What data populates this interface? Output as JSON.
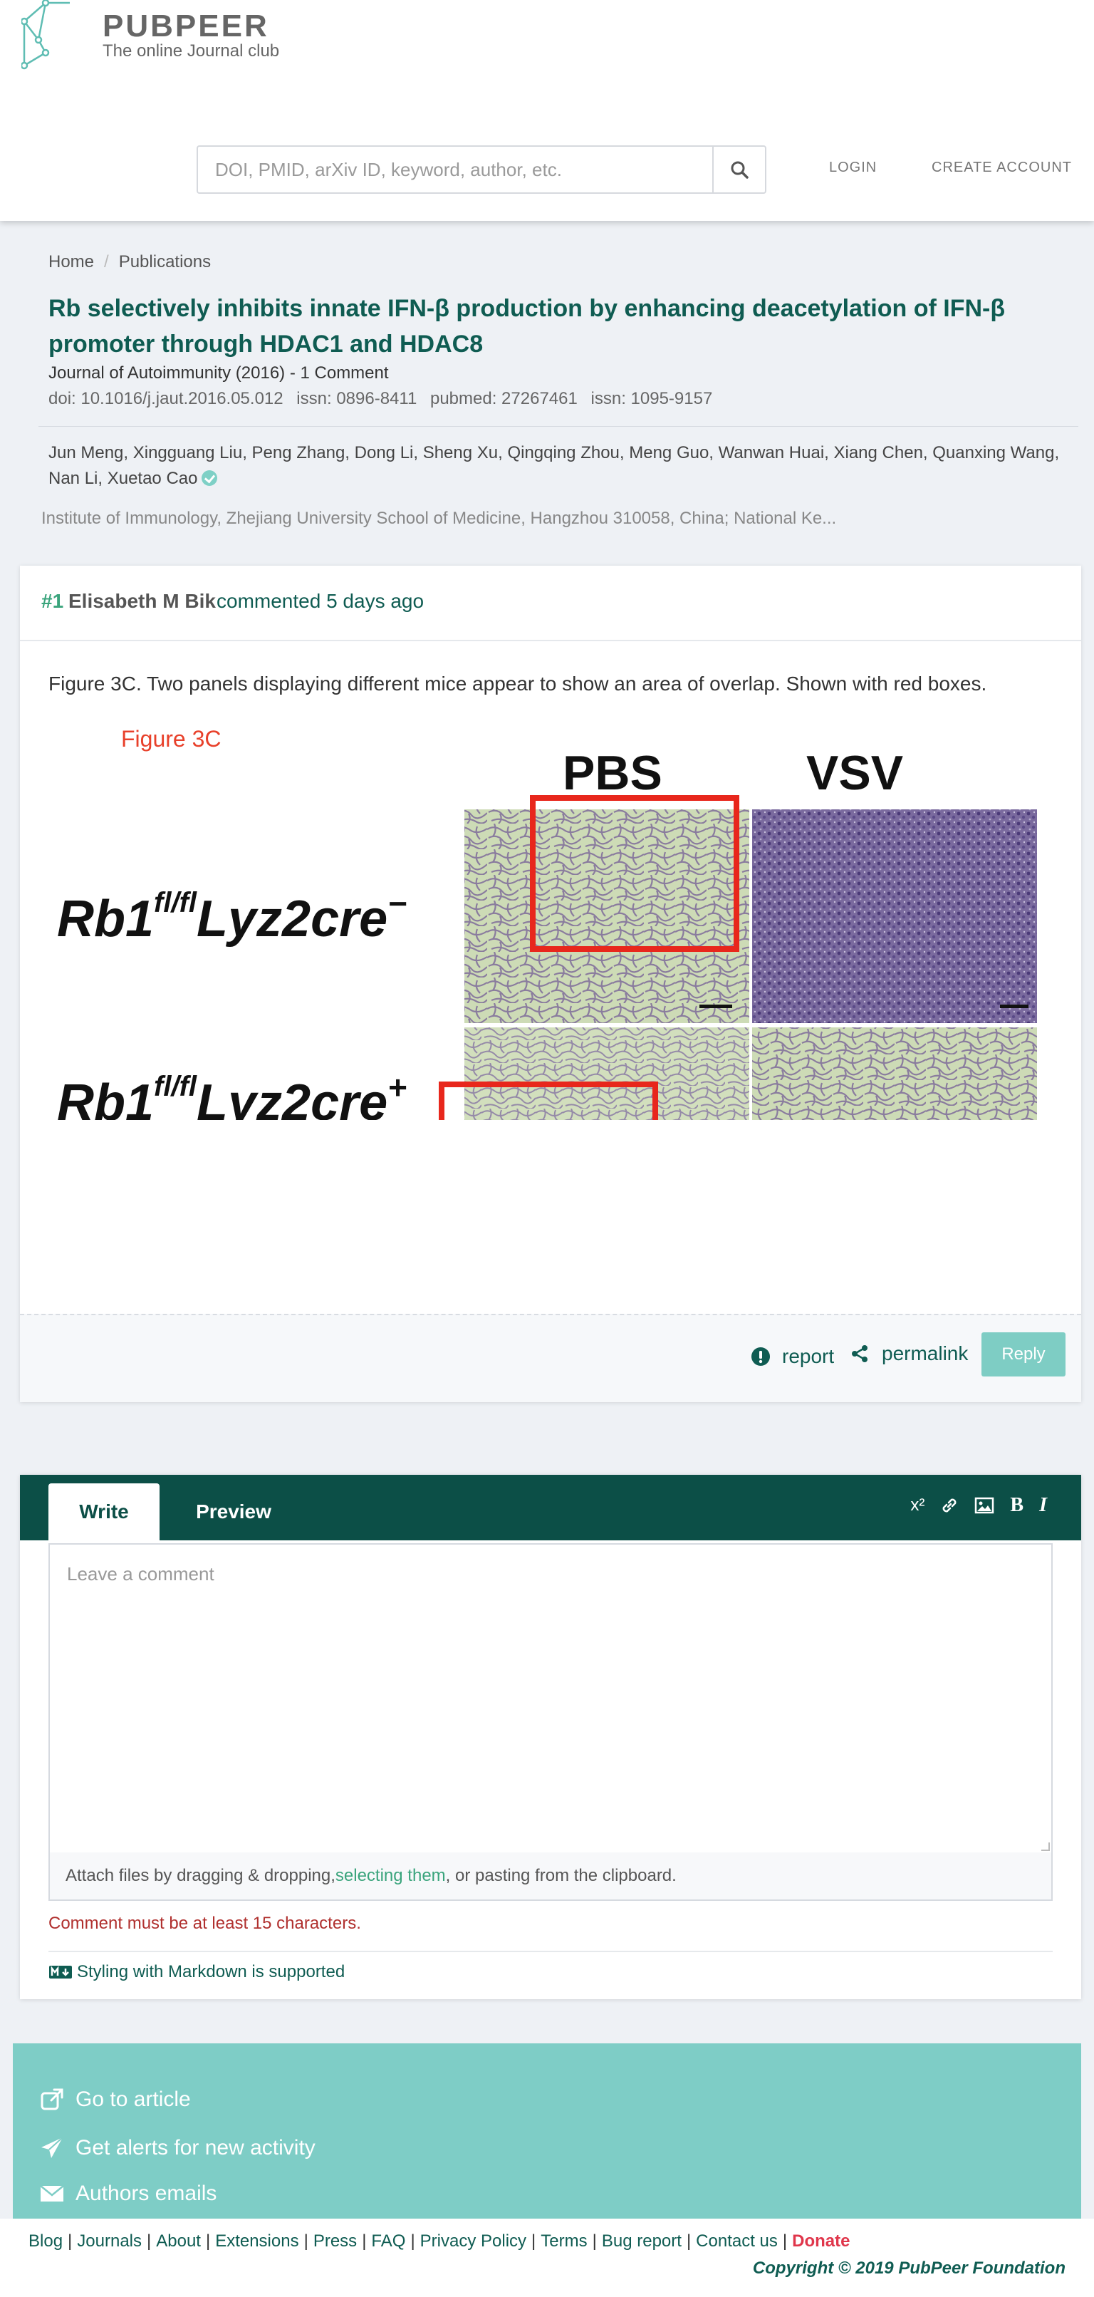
{
  "header": {
    "brand": "PUBPEER",
    "tagline": "The online Journal club",
    "search_placeholder": "DOI, PMID, arXiv ID, keyword, author, etc.",
    "login": "LOGIN",
    "create_account": "CREATE ACCOUNT"
  },
  "breadcrumb": {
    "home": "Home",
    "publications": "Publications"
  },
  "publication": {
    "title": "Rb selectively inhibits innate IFN-β production by enhancing deacetylation of IFN-β promoter through HDAC1 and HDAC8",
    "journal": "Journal of Autoimmunity (2016) - 1 Comment",
    "doi": "doi: 10.1016/j.jaut.2016.05.012",
    "issn1": "issn: 0896-8411",
    "pubmed": "pubmed: 27267461",
    "issn2": "issn: 1095-9157",
    "authors": "Jun Meng, Xingguang Liu, Peng Zhang, Dong Li, Sheng Xu, Qingqing Zhou, Meng Guo, Wanwan Huai, Xiang Chen, Quanxing Wang, Nan Li, Xuetao Cao",
    "affiliation": "Institute of Immunology, Zhejiang University School of Medicine, Hangzhou 310058, China; National Ke..."
  },
  "comment": {
    "number": "#1",
    "author": "Elisabeth M Bik",
    "when": "commented 5 days ago",
    "text": "Figure 3C. Two panels displaying different mice appear to show an area of overlap. Shown with red boxes.",
    "figure": {
      "label": "Figure 3C",
      "col1": "PBS",
      "col2": "VSV",
      "row1_main": "Rb1",
      "row1_sup": "fl/fl",
      "row1_tail": "Lyz2cre",
      "row1_sign": "−",
      "row2_main": "Rb1",
      "row2_sup": "fl/fl",
      "row2_tail": "Lyz2cre",
      "row2_sign": "+"
    },
    "report": "report",
    "permalink": "permalink",
    "reply": "Reply"
  },
  "editor": {
    "tab_write": "Write",
    "tab_preview": "Preview",
    "tool_sup": "x²",
    "tool_bold": "B",
    "tool_italic": "I",
    "placeholder": "Leave a comment",
    "attach_prefix": "Attach files by dragging & dropping, ",
    "attach_link": "selecting them",
    "attach_suffix": ", or pasting from the clipboard.",
    "error": "Comment must be at least 15 characters.",
    "markdown": "Styling with Markdown is supported"
  },
  "actions": {
    "go_to_article": "Go to article",
    "alerts": "Get alerts for new activity",
    "authors_emails": "Authors emails"
  },
  "footer": {
    "links": [
      "Blog",
      "Journals",
      "About",
      "Extensions",
      "Press",
      "FAQ",
      "Privacy Policy",
      "Terms",
      "Bug report",
      "Contact us"
    ],
    "donate": "Donate",
    "copyright": "Copyright © 2019 PubPeer Foundation"
  },
  "colors": {
    "brand_teal": "#0f5c52",
    "panel_teal": "#7ecdc6",
    "accent_green": "#3aa47c",
    "error_red": "#b0302e",
    "donate_red": "#e0364b"
  }
}
